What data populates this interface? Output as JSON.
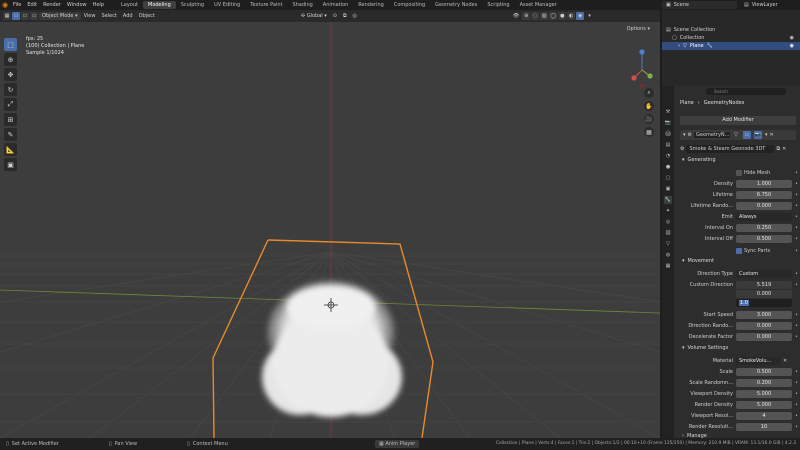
{
  "menu": [
    "File",
    "Edit",
    "Render",
    "Window",
    "Help"
  ],
  "workspaces": [
    "Layout",
    "Modeling",
    "Sculpting",
    "UV Editing",
    "Texture Paint",
    "Shading",
    "Animation",
    "Rendering",
    "Compositing",
    "Geometry Nodes",
    "Scripting",
    "Asset Manager"
  ],
  "active_workspace": "Modeling",
  "scene": "Scene",
  "view_layer": "ViewLayer",
  "viewport_header": {
    "mode": "Object Mode",
    "view": "View",
    "select": "Select",
    "add": "Add",
    "object": "Object",
    "orientation": "Global",
    "options": "Options"
  },
  "viewport_info": {
    "line1": "fps: 25",
    "line2": "(100) Collection | Plane",
    "line3": "Sample 1/1024"
  },
  "outliner": {
    "root": "Scene Collection",
    "collection": "Collection",
    "object": "Plane"
  },
  "properties": {
    "search_placeholder": "Search",
    "breadcrumb_object": "Plane",
    "breadcrumb_modifier": "GeometryNodes",
    "add_modifier": "Add Modifier",
    "modifier_name": "GeometryN...",
    "node_group": "Smoke & Steam Geonode 3DT",
    "sections": {
      "generating": "Generating",
      "movement": "Movement",
      "volume": "Volume Settings",
      "manage": "Manage"
    },
    "generating": {
      "hide_mesh": "Hide Mesh",
      "density_label": "Density",
      "density": "1.000",
      "lifetime_label": "Lifetime",
      "lifetime": "6.750",
      "lifetime_random_label": "Lifetime Rando...",
      "lifetime_random": "0.000",
      "emit_label": "Emit",
      "emit": "Always",
      "interval_on_label": "Interval On",
      "interval_on": "0.250",
      "interval_off_label": "Interval Off",
      "interval_off": "0.500",
      "sync_parts": "Sync Parts"
    },
    "movement": {
      "direction_type_label": "Direction Type",
      "direction_type": "Custom",
      "custom_direction_label": "Custom Direction",
      "dir_x": "5.519",
      "dir_y": "0.000",
      "dir_z": "1.0",
      "start_speed_label": "Start Speed",
      "start_speed": "3.000",
      "direction_random_label": "Direction Rando...",
      "direction_random": "0.000",
      "decelerate_label": "Decelerate Factor",
      "decelerate": "0.000"
    },
    "volume": {
      "material_label": "Material",
      "material": "SmokeVolu...",
      "scale_label": "Scale",
      "scale": "0.500",
      "scale_random_label": "Scale Randomn...",
      "scale_random": "0.200",
      "viewport_density_label": "Viewport Density",
      "viewport_density": "5.000",
      "render_density_label": "Render Density",
      "render_density": "5.000",
      "viewport_res_label": "Viewport Resol...",
      "viewport_res": "4",
      "render_res_label": "Render Resoluti...",
      "render_res": "10"
    }
  },
  "status": {
    "left1": "Set Active Modifier",
    "left2": "Pan View",
    "left3": "Context Menu",
    "anim": "Anim Player",
    "stats": "Collection | Plane | Verts:4 | Faces:1 | Tris:2 | Objects:1/2 | 00:10+10 (Frame 125/250) | Memory: 210.9 MiB | VRAM: 13.1/16.0 GiB | 4.2.3"
  },
  "colors": {
    "accent": "#4a6ea9",
    "selection_outline": "#e88a2a",
    "x_axis": "#8a3a3a",
    "y_axis": "#6e8a35"
  }
}
